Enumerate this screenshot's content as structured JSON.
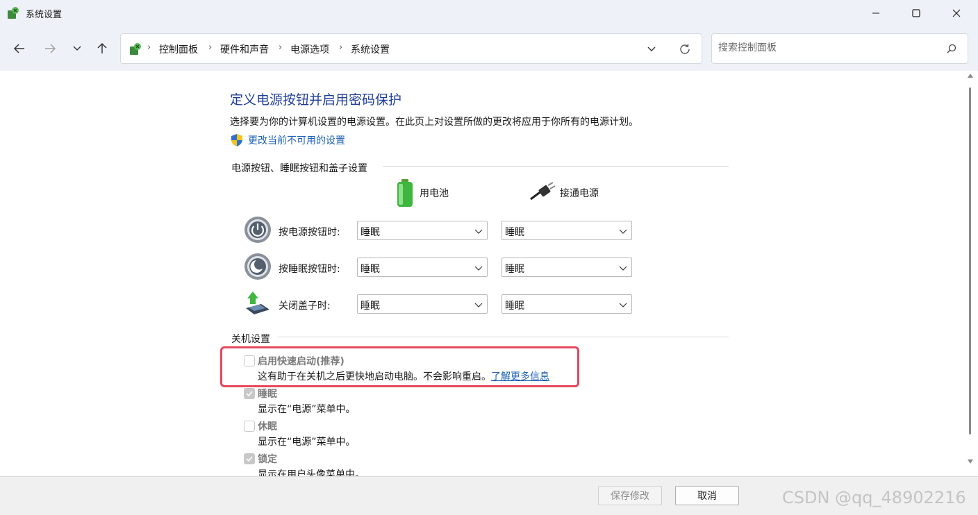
{
  "window": {
    "title": "系统设置",
    "app_icon": "control-panel-icon",
    "controls": [
      "minimize-icon",
      "maximize-icon",
      "close-icon"
    ]
  },
  "nav": {
    "back": "arrow-left-icon",
    "forward": "arrow-right-icon",
    "recent": "chevron-down-icon",
    "up": "arrow-up-icon"
  },
  "breadcrumb": {
    "items": [
      "控制面板",
      "硬件和声音",
      "电源选项",
      "系统设置"
    ],
    "separator": "›"
  },
  "search": {
    "placeholder": "搜索控制面板"
  },
  "main": {
    "title": "定义电源按钮并启用密码保护",
    "description": "选择要为你的计算机设置的电源设置。在此页上对设置所做的更改将应用于你所有的电源计划。",
    "admin_link": "更改当前不可用的设置",
    "power_section": {
      "heading": "电源按钮、睡眠按钮和盖子设置",
      "columns": [
        "用电池",
        "接通电源"
      ],
      "rows": [
        {
          "label": "按电源按钮时:",
          "battery": "睡眠",
          "plugged": "睡眠",
          "icon": "power-button-icon"
        },
        {
          "label": "按睡眠按钮时:",
          "battery": "睡眠",
          "plugged": "睡眠",
          "icon": "sleep-button-icon"
        },
        {
          "label": "关闭盖子时:",
          "battery": "睡眠",
          "plugged": "睡眠",
          "icon": "laptop-lid-icon"
        }
      ]
    },
    "shutdown_section": {
      "heading": "关机设置",
      "options": [
        {
          "label": "启用快速启动(推荐)",
          "desc": "这有助于在关机之后更快地启动电脑。不会影响重启。",
          "link": "了解更多信息",
          "checked": false
        },
        {
          "label": "睡眠",
          "desc": "显示在“电源”菜单中。",
          "checked": true
        },
        {
          "label": "休眠",
          "desc": "显示在“电源”菜单中。",
          "checked": false
        },
        {
          "label": "锁定",
          "desc": "显示在用户头像菜单中。",
          "checked": true
        }
      ]
    }
  },
  "footer": {
    "save": "保存修改",
    "cancel": "取消",
    "watermark": "CSDN @qq_48902216"
  },
  "colors": {
    "title_blue": "#1e3e99",
    "link_blue": "#1a5fb4",
    "highlight": "#e8475c",
    "chrome_bg": "#eef1f7"
  }
}
